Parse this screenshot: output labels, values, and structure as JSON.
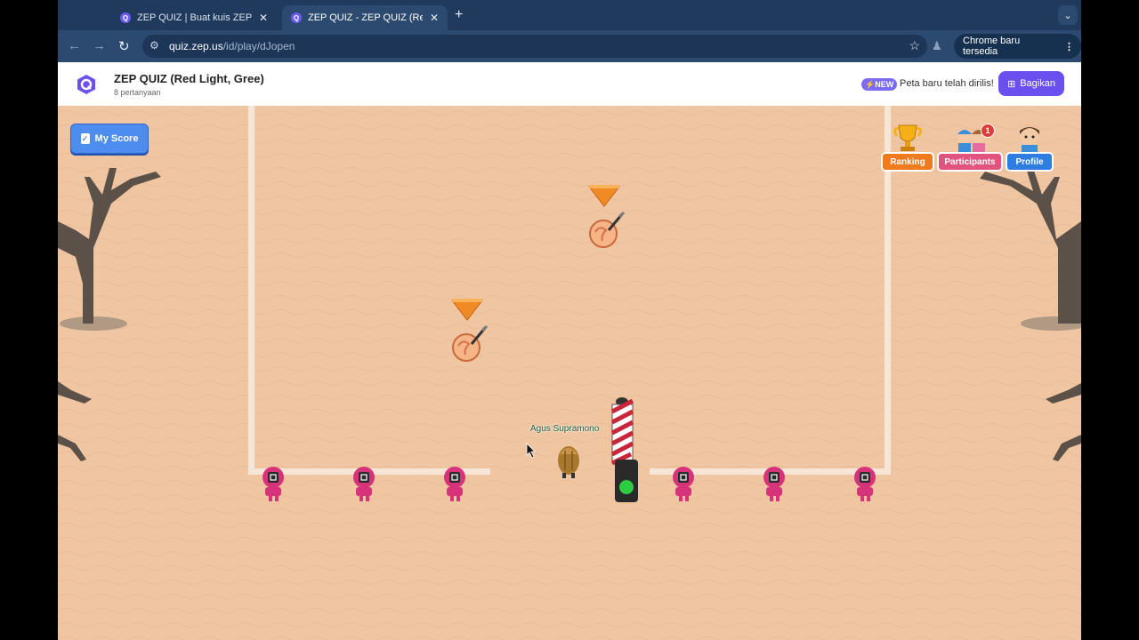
{
  "browser": {
    "tabs": [
      {
        "title": "ZEP QUIZ | Buat kuis ZEP and",
        "active": false
      },
      {
        "title": "ZEP QUIZ - ZEP QUIZ (Red Li",
        "active": true
      }
    ],
    "url_host": "quiz.zep.us",
    "url_path": "/id/play/dJopen",
    "update_label": "Chrome baru tersedia"
  },
  "header": {
    "logo_letter": "Q",
    "title": "ZEP QUIZ (Red Light, Gree)",
    "subtitle": "8 pertanyaan",
    "new_badge": "NEW",
    "new_text": "Peta baru telah dirilis!",
    "share_label": "Bagikan"
  },
  "game": {
    "my_score_label": "My Score",
    "ranking_label": "Ranking",
    "participants_label": "Participants",
    "participants_badge": "1",
    "profile_label": "Profile",
    "player_name": "Agus Supramono",
    "light_color": "#2ecc40",
    "guard_color": "#d6337a"
  }
}
